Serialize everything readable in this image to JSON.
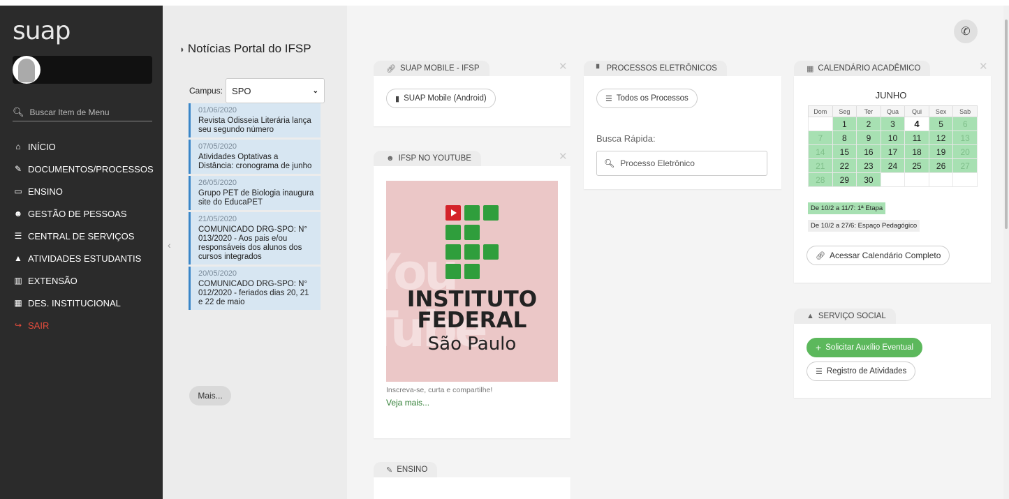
{
  "sidebar": {
    "logo": "suap",
    "search_placeholder": "Buscar Item de Menu",
    "menu": [
      {
        "icon": "home-icon",
        "glyph": "🏠",
        "label": "INÍCIO"
      },
      {
        "icon": "document-edit-icon",
        "glyph": "✎",
        "label": "DOCUMENTOS/PROCESSOS"
      },
      {
        "icon": "board-icon",
        "glyph": "▭",
        "label": "ENSINO"
      },
      {
        "icon": "people-icon",
        "glyph": "👥",
        "label": "GESTÃO DE PESSOAS"
      },
      {
        "icon": "list-icon",
        "glyph": "☰",
        "label": "CENTRAL DE SERVIÇOS"
      },
      {
        "icon": "graduation-cap-icon",
        "glyph": "🎓",
        "label": "ATIVIDADES ESTUDANTIS"
      },
      {
        "icon": "columns-icon",
        "glyph": "▥",
        "label": "EXTENSÃO"
      },
      {
        "icon": "chart-icon",
        "glyph": "📊",
        "label": "DES. INSTITUCIONAL"
      },
      {
        "icon": "sign-out-icon",
        "glyph": "↪",
        "label": "SAIR"
      }
    ]
  },
  "news": {
    "title": "Notícias Portal do IFSP",
    "campus_label": "Campus:",
    "campus_value": "SPO",
    "items": [
      {
        "date": "01/06/2020",
        "text": "Revista Odisseia Literária lança seu segundo número"
      },
      {
        "date": "07/05/2020",
        "text": "Atividades Optativas a Distância: cronograma de junho"
      },
      {
        "date": "26/05/2020",
        "text": "Grupo PET de Biologia inaugura site do EducaPET"
      },
      {
        "date": "21/05/2020",
        "text": "COMUNICADO DRG-SPO: N° 013/2020 - Aos pais e/ou responsáveis dos alunos dos cursos integrados"
      },
      {
        "date": "20/05/2020",
        "text": "COMUNICADO DRG-SPO: N° 012/2020 - feriados dias 20, 21 e 22 de maio"
      }
    ],
    "more_label": "Mais..."
  },
  "cards": {
    "mobile": {
      "tab": "SUAP MOBILE - IFSP",
      "button": "SUAP Mobile (Android)"
    },
    "processos": {
      "tab": "PROCESSOS ELETRÔNICOS",
      "button": "Todos os Processos",
      "quick_label": "Busca Rápida:",
      "search_placeholder": "Processo Eletrônico"
    },
    "youtube": {
      "tab": "IFSP NO YOUTUBE",
      "image_line1": "INSTITUTO",
      "image_line2": "FEDERAL",
      "image_line3": "São Paulo",
      "caption": "Inscreva-se, curta e compartilhe!",
      "link": "Veja mais..."
    },
    "ensino": {
      "tab": "ENSINO"
    },
    "calendario": {
      "tab": "CALENDÁRIO ACADÊMICO",
      "month": "JUNHO",
      "weekdays": [
        "Dom",
        "Seg",
        "Ter",
        "Qua",
        "Qui",
        "Sex",
        "Sab"
      ],
      "legend1": "De 10/2 a 11/7: 1ª Etapa",
      "legend2": "De 10/2 a 27/6: Espaço Pedagógico",
      "button": "Acessar Calendário Completo"
    },
    "servico_social": {
      "tab": "SERVIÇO SOCIAL",
      "button_primary": "Solicitar Auxílio Eventual",
      "button_secondary": "Registro de Atividades"
    }
  }
}
